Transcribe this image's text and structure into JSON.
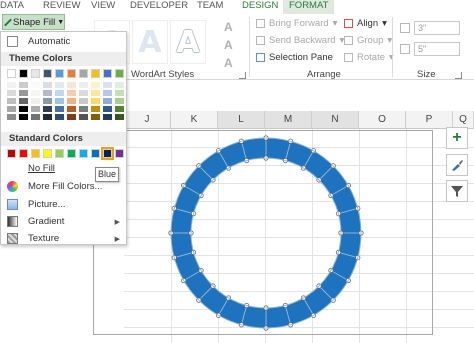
{
  "ribbon_tabs": {
    "data": "DATA",
    "review": "REVIEW",
    "view": "VIEW",
    "developer": "DEVELOPER",
    "team": "TEAM",
    "design": "DESIGN",
    "format": "FORMAT"
  },
  "shape_fill_label": "Shape Fill",
  "groups": {
    "wordart_styles": "WordArt Styles",
    "arrange": "Arrange",
    "size": "Size"
  },
  "wordart_glyph": "A",
  "arrange": {
    "bring_forward": "Bring Forward",
    "send_backward": "Send Backward",
    "selection_pane": "Selection Pane",
    "align": "Align",
    "group": "Group",
    "rotate": "Rotate"
  },
  "size": {
    "height_value": "3\"",
    "width_value": "5\""
  },
  "fill_menu": {
    "automatic": "Automatic",
    "theme_colors_header": "Theme Colors",
    "standard_colors_header": "Standard Colors",
    "no_fill": "No Fill",
    "more_fill_colors": "More Fill Colors...",
    "picture": "Picture...",
    "gradient": "Gradient",
    "texture": "Texture",
    "tooltip": "Blue",
    "theme_colors_top": [
      "#ffffff",
      "#000000",
      "#e7e6e6",
      "#44546a",
      "#5b9bd5",
      "#ed7d31",
      "#a5a5a5",
      "#ffc000",
      "#4472c4",
      "#70ad47"
    ],
    "standard_colors": [
      "#c00000",
      "#ff0000",
      "#ffc000",
      "#ffff00",
      "#92d050",
      "#00b050",
      "#00b0f0",
      "#0070c0",
      "#002060",
      "#7030a0"
    ]
  },
  "columns": [
    "J",
    "K",
    "L",
    "M",
    "N",
    "O",
    "P",
    "Q"
  ],
  "shape_color": "#1e73be",
  "accent_green": "#2a7a3a"
}
